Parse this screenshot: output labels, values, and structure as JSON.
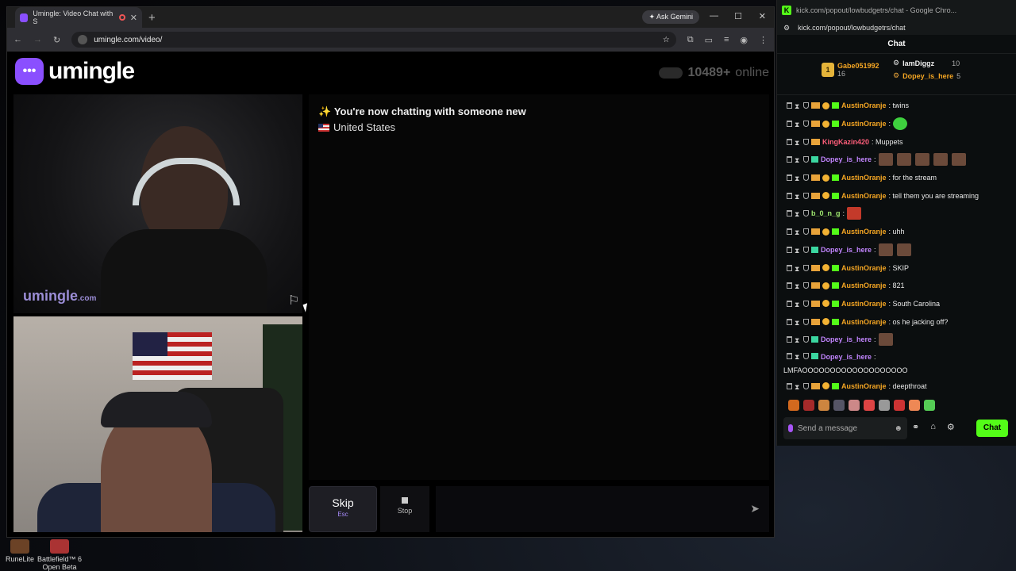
{
  "browser": {
    "tab_title": "Umingle: Video Chat with S",
    "url": "umingle.com/video/",
    "ask_gemini": "Ask Gemini"
  },
  "page": {
    "logo_text": "umingle",
    "online_count": "10489+",
    "online_label": "online",
    "watermark": "umingle",
    "watermark_suffix": ".com",
    "status_message": "You're now chatting with someone new",
    "country": "United States",
    "skip_label": "Skip",
    "skip_hint": "Esc",
    "stop_label": "Stop"
  },
  "desktop": {
    "icons": [
      "RuneLite",
      "Battlefield™ 6 Open Beta"
    ]
  },
  "kick": {
    "window_title": "kick.com/popout/lowbudgetrs/chat - Google Chro...",
    "url": "kick.com/popout/lowbudgetrs/chat",
    "header": "Chat",
    "leaderboard": {
      "first": {
        "name": "Gabe051992",
        "count": "16"
      },
      "second": {
        "name": "IamDiggz",
        "count": "10"
      },
      "third": {
        "name": "Dopey_is_here",
        "count": "5"
      }
    },
    "messages": [
      {
        "user": "AustinOranje",
        "text": ": twins",
        "color": "#f5a623",
        "badges": "vip"
      },
      {
        "user": "AustinOranje",
        "text": ":",
        "color": "#f5a623",
        "badges": "vip",
        "emotes": "green"
      },
      {
        "user": "KingKazin420",
        "text": ": Muppets",
        "color": "#ff5e7a",
        "badges": "crown"
      },
      {
        "user": "Dopey_is_here",
        "text": ":",
        "color": "#c084fc",
        "badges": "teal",
        "emotes": "five"
      },
      {
        "user": "AustinOranje",
        "text": ": for the stream",
        "color": "#f5a623",
        "badges": "vip"
      },
      {
        "user": "AustinOranje",
        "text": ": tell them you are streaming",
        "color": "#f5a623",
        "badges": "vip"
      },
      {
        "user": "b_0_n_g",
        "text": ":",
        "color": "#9fe870",
        "badges": "plain",
        "emotes": "red"
      },
      {
        "user": "AustinOranje",
        "text": ": uhh",
        "color": "#f5a623",
        "badges": "vip"
      },
      {
        "user": "Dopey_is_here",
        "text": ":",
        "color": "#c084fc",
        "badges": "teal",
        "emotes": "two"
      },
      {
        "user": "AustinOranje",
        "text": ": SKIP",
        "color": "#f5a623",
        "badges": "vip"
      },
      {
        "user": "AustinOranje",
        "text": ": 821",
        "color": "#f5a623",
        "badges": "vip"
      },
      {
        "user": "AustinOranje",
        "text": ": South Carolina",
        "color": "#f5a623",
        "badges": "vip"
      },
      {
        "user": "AustinOranje",
        "text": ": os he jacking off?",
        "color": "#f5a623",
        "badges": "vip"
      },
      {
        "user": "Dopey_is_here",
        "text": ":",
        "color": "#c084fc",
        "badges": "teal",
        "emotes": "one"
      },
      {
        "user": "Dopey_is_here",
        "text": ":",
        "color": "#c084fc",
        "badges": "teal",
        "extra": "LMFAOOOOOOOOOOOOOOOOOOO"
      },
      {
        "user": "AustinOranje",
        "text": ": deepthroat",
        "color": "#f5a623",
        "badges": "vip"
      }
    ],
    "input_placeholder": "Send a message",
    "chat_button": "Chat"
  }
}
